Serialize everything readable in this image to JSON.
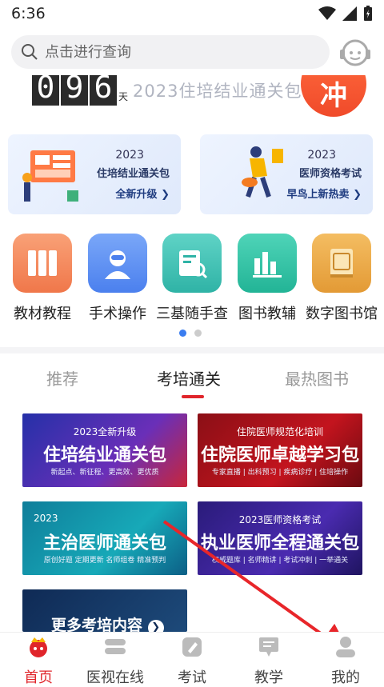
{
  "status": {
    "time": "6:36"
  },
  "search": {
    "placeholder": "点击进行查询"
  },
  "promo": {
    "digits": [
      "0",
      "9",
      "6"
    ],
    "day_unit": "天",
    "text": "2023住培结业通关包",
    "button": "冲"
  },
  "cards": [
    {
      "year": "2023",
      "title": "住培结业通关包",
      "cta": "全新升级"
    },
    {
      "year": "2023",
      "title": "医师资格考试",
      "cta": "早鸟上新热卖"
    }
  ],
  "grid": [
    {
      "label": "教材教程",
      "icon": "books-icon",
      "color": "#f5895a"
    },
    {
      "label": "手术操作",
      "icon": "surgeon-icon",
      "color": "#5b8ff4"
    },
    {
      "label": "三基随手查",
      "icon": "search-doc-icon",
      "color": "#3ec3b8"
    },
    {
      "label": "图书教辅",
      "icon": "bar-chart-icon",
      "color": "#33c2a6"
    },
    {
      "label": "数字图书馆",
      "icon": "library-book-icon",
      "color": "#e9a64a"
    }
  ],
  "tabs": {
    "recommend": "推荐",
    "exam": "考培通关",
    "hot_books": "最热图书"
  },
  "courses": [
    {
      "top": "2023全新升级",
      "main": "住培结业通关包",
      "sub": "新起点、新征程、更高效、更优质"
    },
    {
      "top": "住院医师规范化培训",
      "main": "住院医师卓越学习包",
      "sub": "专家直播 | 出科预习 | 疾病诊疗 | 住培操作"
    },
    {
      "top": "2023",
      "main": "主治医师通关包",
      "sub": "原创好题    定期更新    名师组卷    精准预判"
    },
    {
      "top": "2023医师资格考试",
      "main": "执业医师全程通关包",
      "sub": "权威题库 | 名师精讲 | 考试冲刺 | 一举通关"
    },
    {
      "main": "更多考培内容"
    }
  ],
  "tabbar": [
    "首页",
    "医视在线",
    "考试",
    "教学",
    "我的"
  ],
  "colors": {
    "brand_red": "#e0252b",
    "accent_blue": "#3a7df0",
    "arrow_red": "#e8262a"
  }
}
